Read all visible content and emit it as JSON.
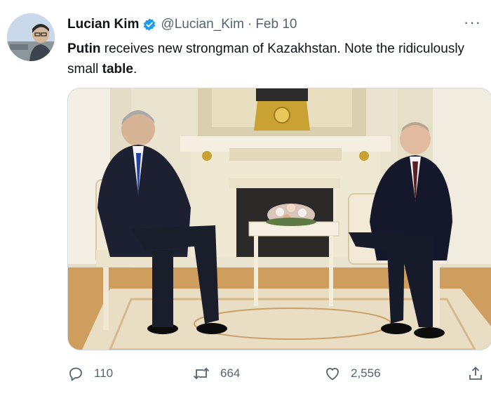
{
  "tweet": {
    "author": {
      "name": "Lucian Kim",
      "handle": "@Lucian_Kim",
      "verified": true
    },
    "separator": "·",
    "date": "Feb 10",
    "more_icon": "more-icon",
    "text_parts": [
      "Putin",
      " receives new strongman of Kazakhstan. Note the ridiculously small ",
      "table",
      "."
    ],
    "media": {
      "type": "photo",
      "subject": "Putin receiving Tokayev in Kremlin room beside fireplace with small table"
    },
    "actions": {
      "reply_count": "110",
      "retweet_count": "664",
      "like_count": "2,556"
    }
  },
  "colors": {
    "text": "#0f1419",
    "secondary": "#536471",
    "verified": "#1d9bf0"
  }
}
